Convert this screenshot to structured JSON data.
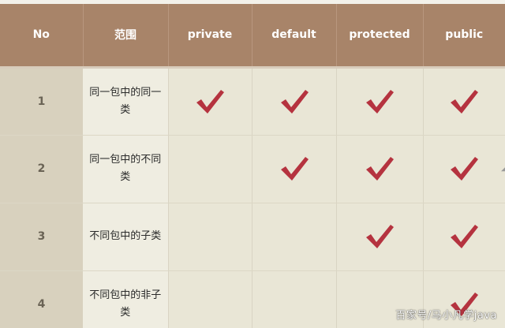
{
  "table": {
    "headers": [
      "No",
      "范围",
      "private",
      "default",
      "protected",
      "public"
    ],
    "rows": [
      {
        "no": "1",
        "scope": "同一包中的同一类",
        "access": [
          true,
          true,
          true,
          true
        ]
      },
      {
        "no": "2",
        "scope": "同一包中的不同类",
        "access": [
          false,
          true,
          true,
          true
        ]
      },
      {
        "no": "3",
        "scope": "不同包中的子类",
        "access": [
          false,
          false,
          true,
          true
        ]
      },
      {
        "no": "4",
        "scope": "不同包中的非子类",
        "access": [
          false,
          false,
          false,
          true
        ]
      }
    ]
  },
  "colors": {
    "header_bg": "#a88469",
    "header_text": "#ffffff",
    "check": "#b5333f",
    "body_bg": "#e9e6d6",
    "no_col_bg": "#d8d1be"
  },
  "icons": {
    "check": "check-mark-icon"
  },
  "watermark": "百家号/马小凡学java"
}
